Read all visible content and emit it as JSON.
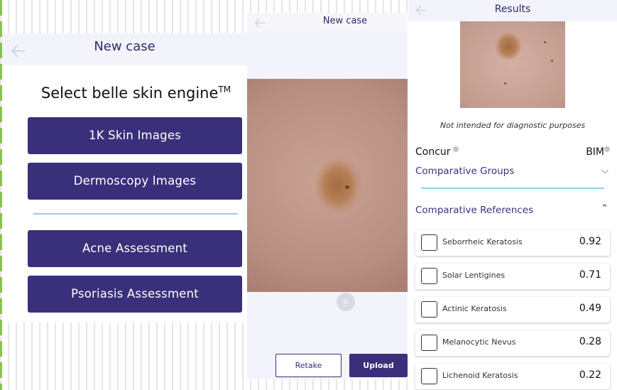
{
  "panel1": {
    "header_title": "New case",
    "heading": "Select belle skin engine",
    "trademark": "TM",
    "engines": [
      "1K Skin Images",
      "Dermoscopy Images",
      "Acne Assessment",
      "Psoriasis Assessment"
    ]
  },
  "panel2": {
    "header_title": "New case",
    "retake_label": "Retake",
    "upload_label": "Upload"
  },
  "panel3": {
    "header_title": "Results",
    "disclaimer": "Not intended for diagnostic purposes",
    "tab_concur": "Concur",
    "tab_bim": "BIM",
    "groups_title": "Comparative Groups",
    "references_title": "Comparative References",
    "references": [
      {
        "name": "Seborrheic Keratosis",
        "score": "0.92"
      },
      {
        "name": "Solar Lentigines",
        "score": "0.71"
      },
      {
        "name": "Actinic Keratosis",
        "score": "0.49"
      },
      {
        "name": "Melanocytic Nevus",
        "score": "0.28"
      },
      {
        "name": "Lichenoid Keratosis",
        "score": "0.22"
      }
    ]
  },
  "icons": {
    "back": "arrow-left-icon",
    "crop": "crop-icon",
    "expand": "chevron-down-icon",
    "collapse": "chevron-up-icon",
    "info": "info-dot-icon"
  },
  "colors": {
    "primary": "#3a2f7a",
    "accent": "#8fd3e6",
    "header_bg": "#f2f3fb"
  }
}
